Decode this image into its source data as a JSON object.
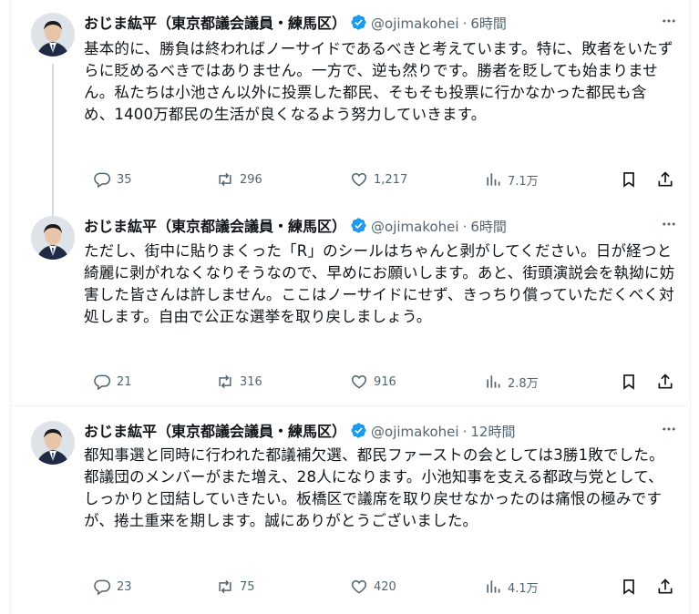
{
  "author": {
    "name": "おじま紘平（東京都議会議員・練馬区）",
    "handle": "@ojimakohei",
    "separator": "·"
  },
  "tweets": [
    {
      "time": "6時間",
      "text": "基本的に、勝負は終わればノーサイドであるべきと考えています。特に、敗者をいたずらに貶めるべきではありません。一方で、逆も然りです。勝者を貶しても始まりません。私たちは小池さん以外に投票した都民、そもそも投票に行かなかった都民も含め、1400万都民の生活が良くなるよう努力していきます。",
      "replies": "35",
      "retweets": "296",
      "likes": "1,217",
      "views": "7.1万"
    },
    {
      "time": "6時間",
      "text": "ただし、街中に貼りまくった「R」のシールはちゃんと剥がしてください。日が経つと綺麗に剥がれなくなりそうなので、早めにお願いします。あと、街頭演説会を執拗に妨害した皆さんは許しません。ここはノーサイドにせず、きっちり償っていただくべく対処します。自由で公正な選挙を取り戻しましょう。",
      "replies": "21",
      "retweets": "316",
      "likes": "916",
      "views": "2.8万"
    },
    {
      "time": "12時間",
      "text": "都知事選と同時に行われた都議補欠選、都民ファーストの会としては3勝1敗でした。都議団のメンバーがまた増え、28人になります。小池知事を支える都政与党として、しっかりと団結していきたい。板橋区で議席を取り戻せなかったのは痛恨の極みですが、捲土重来を期します。誠にありがとうございました。",
      "replies": "23",
      "retweets": "75",
      "likes": "420",
      "views": "4.1万"
    }
  ],
  "icons": {
    "verified": "verified-badge-icon",
    "more": "more-icon",
    "reply": "reply-icon",
    "retweet": "retweet-icon",
    "like": "heart-icon",
    "views": "views-icon",
    "bookmark": "bookmark-icon",
    "share": "share-icon"
  },
  "colors": {
    "text": "#0f1419",
    "secondary": "#536471",
    "verified": "#1d9bf0",
    "divider": "#eff3f4",
    "thread_line": "#cfd9de"
  }
}
